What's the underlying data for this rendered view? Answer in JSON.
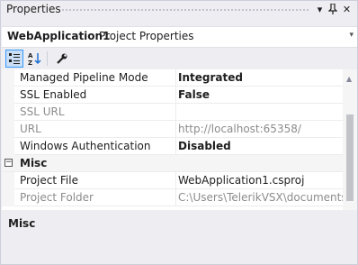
{
  "window": {
    "title": "Properties",
    "dropdown_glyph": "▾",
    "pin_glyph": "ᚔ",
    "close_glyph": "✕"
  },
  "object_selector": {
    "name": "WebApplication1",
    "type": "Project Properties",
    "dropdown_glyph": "▾"
  },
  "toolbar": {
    "categorized_icon": "categorized-icon",
    "alphabetical_icon": "alphabetical-icon",
    "property_pages_icon": "wrench-icon"
  },
  "grid": {
    "rows": [
      {
        "kind": "prop",
        "name": "Managed Pipeline Mode",
        "value": "Integrated",
        "value_style": "bold",
        "readonly": false
      },
      {
        "kind": "prop",
        "name": "SSL Enabled",
        "value": "False",
        "value_style": "bold",
        "readonly": false
      },
      {
        "kind": "prop",
        "name": "SSL URL",
        "value": "",
        "value_style": "normal",
        "readonly": true
      },
      {
        "kind": "prop",
        "name": "URL",
        "value": "http://localhost:65358/",
        "value_style": "normal",
        "readonly": true
      },
      {
        "kind": "prop",
        "name": "Windows Authentication",
        "value": "Disabled",
        "value_style": "bold",
        "readonly": false
      },
      {
        "kind": "category",
        "name": "Misc",
        "toggle": "−"
      },
      {
        "kind": "prop",
        "name": "Project File",
        "value": "WebApplication1.csproj",
        "value_style": "normal",
        "readonly": false
      },
      {
        "kind": "prop",
        "name": "Project Folder",
        "value": "C:\\Users\\TelerikVSX\\documents\\vi",
        "value_style": "normal",
        "readonly": true
      }
    ]
  },
  "description": {
    "title": "Misc"
  },
  "scrollbar": {
    "up_glyph": "▲"
  }
}
